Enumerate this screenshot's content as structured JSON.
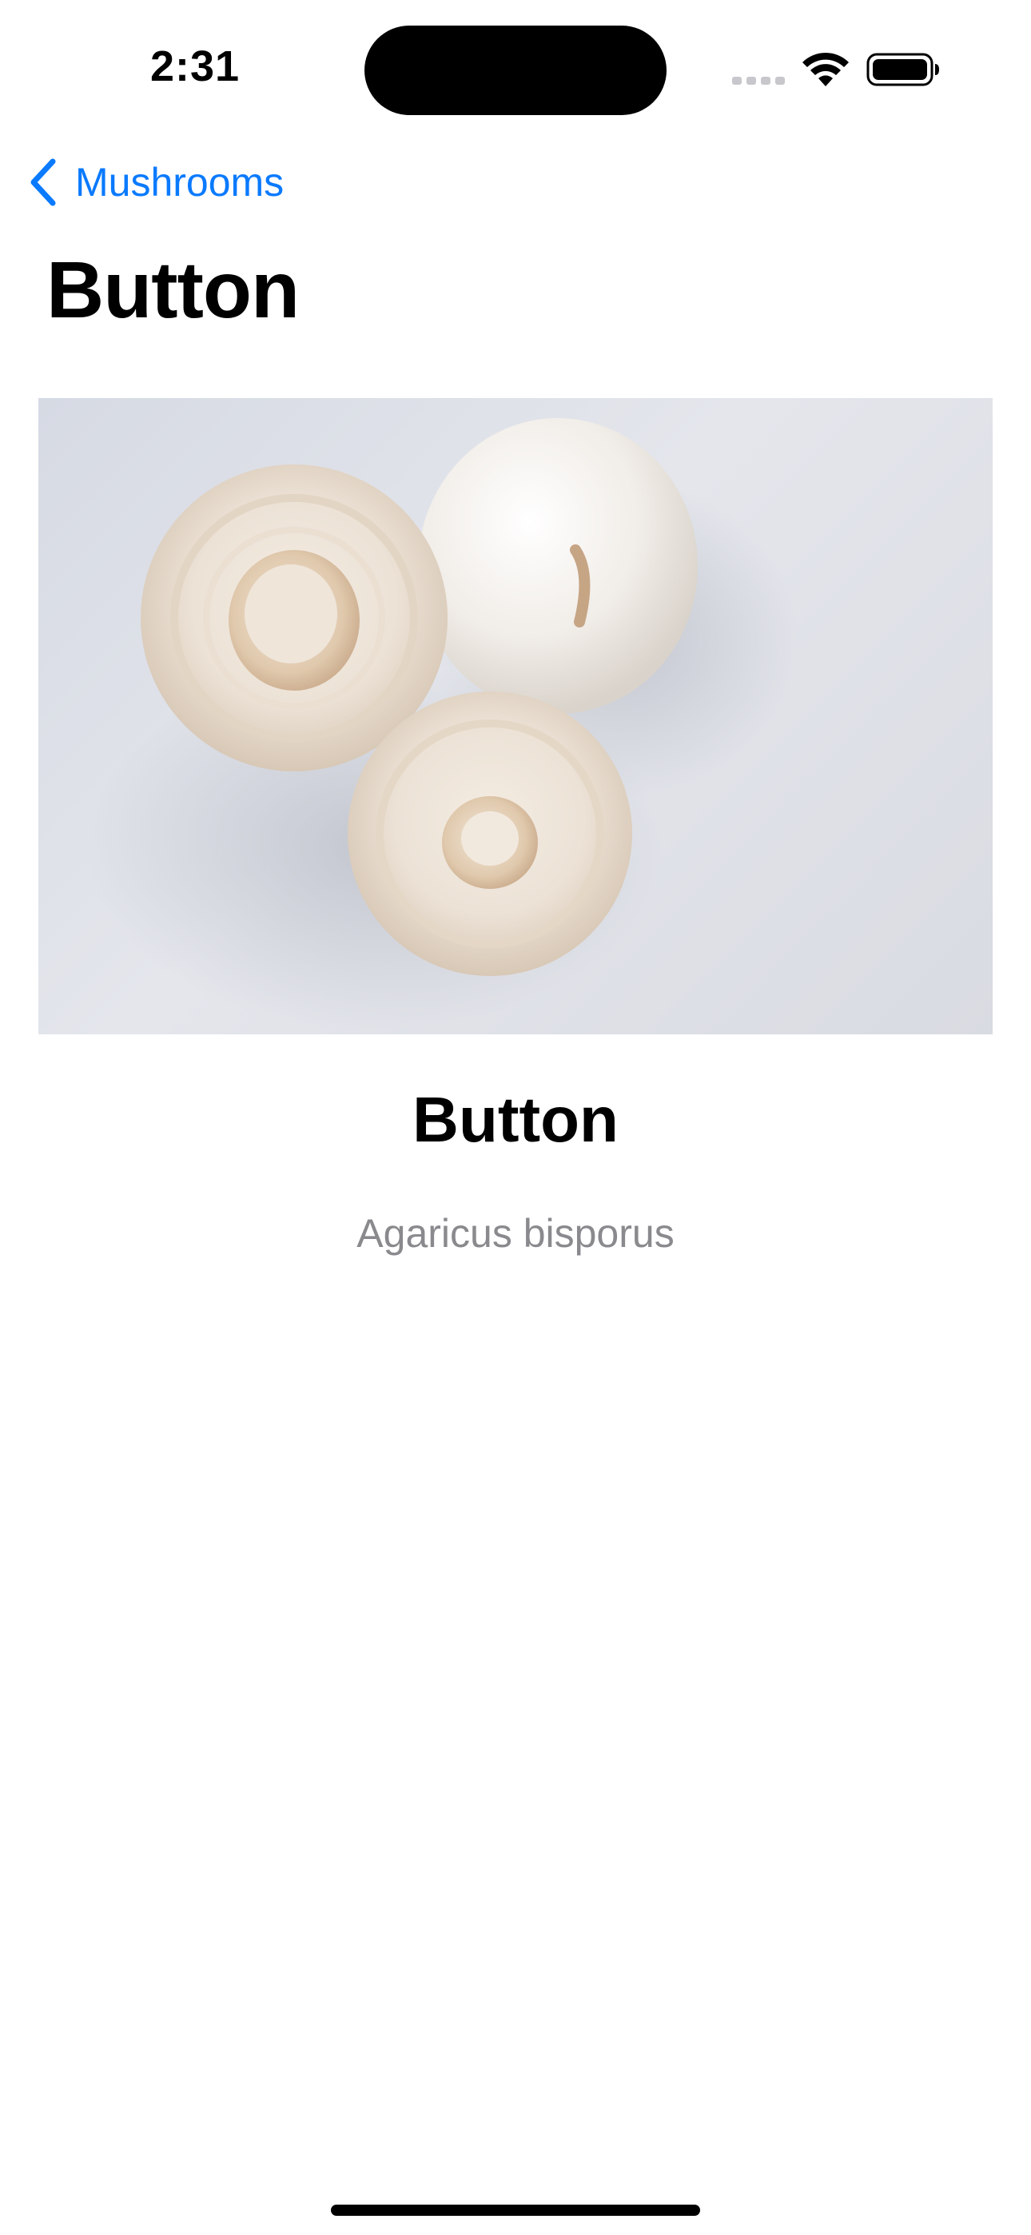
{
  "status_bar": {
    "time": "2:31",
    "icons": [
      "cellular-signal-icon",
      "wifi-icon",
      "battery-icon"
    ]
  },
  "nav": {
    "back_label": "Mushrooms",
    "back_icon": "chevron-left-icon",
    "accent_color": "#0a7aff"
  },
  "page": {
    "title": "Button"
  },
  "detail": {
    "image_subject": "mushroom-photo",
    "name": "Button",
    "scientific_name": "Agaricus bisporus",
    "secondary_text_color": "#8a8a8e"
  }
}
